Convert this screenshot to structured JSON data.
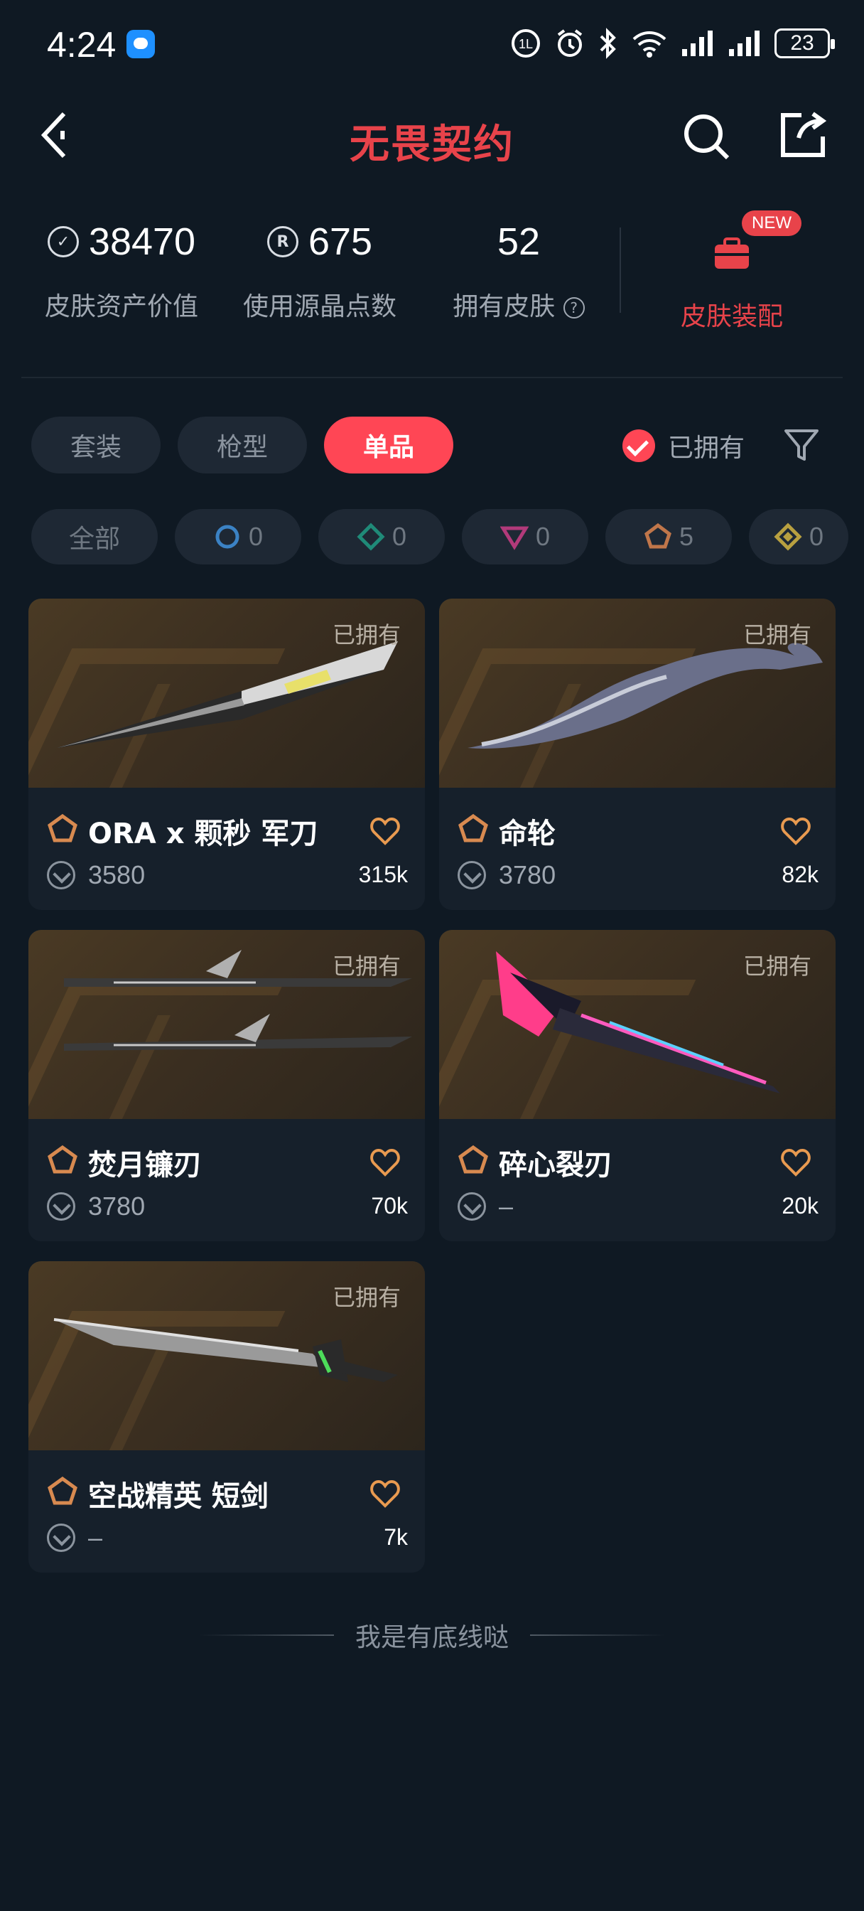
{
  "status_bar": {
    "time": "4:24",
    "battery": "23"
  },
  "header": {
    "title": "无畏契约"
  },
  "stats": [
    {
      "value": "38470",
      "label": "皮肤资产价值",
      "icon": "vp-coin-icon"
    },
    {
      "value": "675",
      "label": "使用源晶点数",
      "icon": "radianite-coin-icon"
    },
    {
      "value": "52",
      "label": "拥有皮肤",
      "icon": "help-icon"
    }
  ],
  "equip": {
    "badge": "NEW",
    "label": "皮肤装配"
  },
  "tabs": [
    {
      "label": "套装",
      "active": false
    },
    {
      "label": "枪型",
      "active": false
    },
    {
      "label": "单品",
      "active": true
    }
  ],
  "owned_filter": {
    "label": "已拥有",
    "checked": true
  },
  "tiers": [
    {
      "label": "全部"
    },
    {
      "count": "0",
      "color": "#3b82c4",
      "shape": "circle"
    },
    {
      "count": "0",
      "color": "#1f8a78",
      "shape": "diamond"
    },
    {
      "count": "0",
      "color": "#b23a7a",
      "shape": "triangle"
    },
    {
      "count": "5",
      "color": "#c0764a",
      "shape": "pentagon"
    },
    {
      "count": "0",
      "color": "#b8a040",
      "shape": "diamond-gold"
    }
  ],
  "cards": [
    {
      "owned": "已拥有",
      "name": "ORA x 颗秒 军刀",
      "price": "3580",
      "likes": "315k"
    },
    {
      "owned": "已拥有",
      "name": "命轮",
      "price": "3780",
      "likes": "82k"
    },
    {
      "owned": "已拥有",
      "name": "焚月镰刃",
      "price": "3780",
      "likes": "70k"
    },
    {
      "owned": "已拥有",
      "name": "碎心裂刃",
      "price": "–",
      "likes": "20k"
    },
    {
      "owned": "已拥有",
      "name": "空战精英 短剑",
      "price": "–",
      "likes": "7k"
    }
  ],
  "footer": {
    "text": "我是有底线哒"
  }
}
